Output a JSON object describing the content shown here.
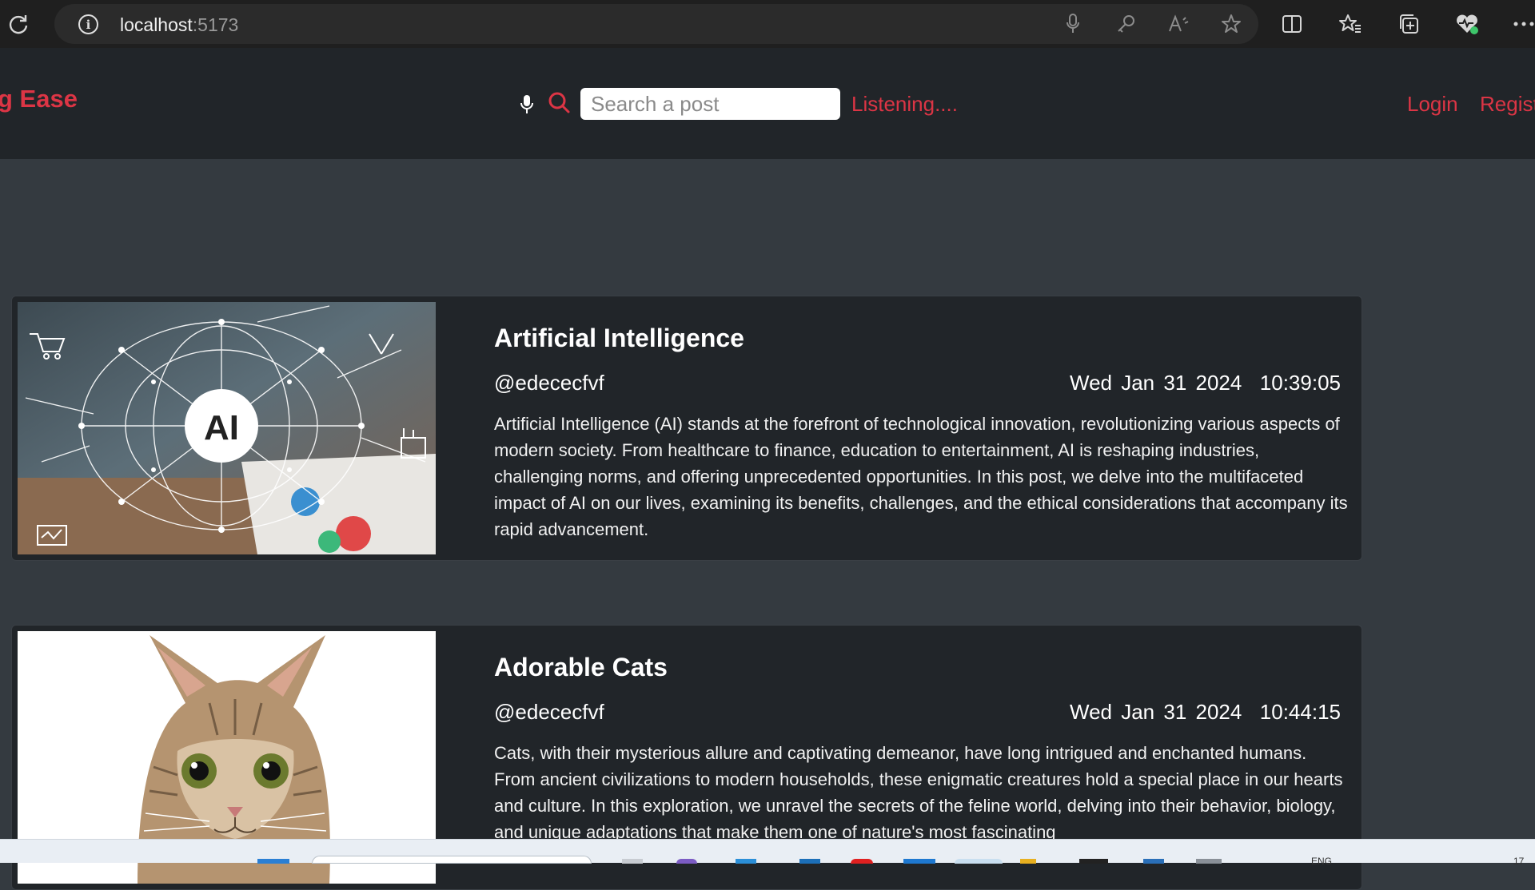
{
  "browser": {
    "url_host": "localhost",
    "url_port": ":5173"
  },
  "header": {
    "brand": "g Ease",
    "search_placeholder": "Search a post",
    "status": "Listening....",
    "nav": {
      "login": "Login",
      "register": "Regist"
    }
  },
  "posts": [
    {
      "title": "Artificial Intelligence",
      "author": "@edececfvf",
      "date": "Wed Jan 31 2024  10:39:05",
      "body": "Artificial Intelligence (AI) stands at the forefront of technological innovation, revolutionizing various aspects of modern society. From healthcare to finance, education to entertainment, AI is reshaping industries, challenging norms, and offering unprecedented opportunities. In this post, we delve into the multifaceted impact of AI on our lives, examining its benefits, challenges, and the ethical considerations that accompany its rapid advancement.",
      "image_label": "AI"
    },
    {
      "title": "Adorable Cats",
      "author": "@edececfvf",
      "date": "Wed Jan 31 2024  10:44:15",
      "body": "Cats, with their mysterious allure and captivating demeanor, have long intrigued and enchanted humans. From ancient civilizations to modern households, these enigmatic creatures hold a special place in our hearts and culture. In this exploration, we unravel the secrets of the feline world, delving into their behavior, biology, and unique adaptations that make them one of nature's most fascinating"
    }
  ],
  "taskbar": {
    "language": "ENG",
    "clock": "17"
  },
  "colors": {
    "accent": "#dc3545",
    "page_bg": "#343a40",
    "card_bg": "#212529"
  },
  "icons": {
    "browser": [
      "reload-icon",
      "info-icon",
      "microphone-icon",
      "key-icon",
      "read-aloud-icon",
      "favorite-star-icon",
      "split-screen-icon",
      "favorites-icon",
      "collections-icon",
      "browser-essentials-icon",
      "more-icon"
    ],
    "header": [
      "microphone-icon",
      "search-icon"
    ]
  }
}
